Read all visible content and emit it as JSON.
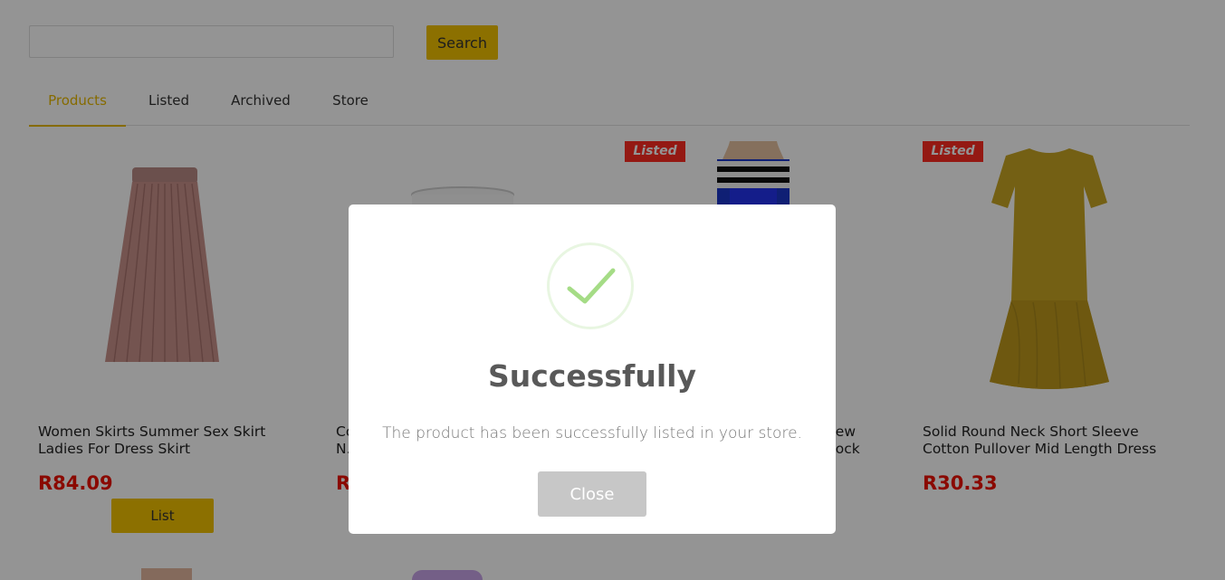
{
  "search": {
    "value": "",
    "placeholder": "",
    "button_label": "Search"
  },
  "tabs": [
    {
      "label": "Products",
      "active": true
    },
    {
      "label": "Listed",
      "active": false
    },
    {
      "label": "Archived",
      "active": false
    },
    {
      "label": "Store",
      "active": false
    }
  ],
  "products": [
    {
      "title": "Women Skirts Summer Sex Skirt Ladies For Dress Skirt",
      "price": "R84.09",
      "button_label": "List",
      "listed": false,
      "image": "pink-pleated-skirt",
      "color": "#c38e88"
    },
    {
      "title": "Co...",
      "title_line2": "N...",
      "price": "R...",
      "listed": false,
      "image": "glass-container",
      "color": "#e8e8e8"
    },
    {
      "title": "...ew",
      "title_line2": "...ock",
      "listed": true,
      "badge": "Listed",
      "image": "striped-dress",
      "color": "#1b36c9"
    },
    {
      "title": "Solid Round Neck Short Sleeve Cotton Pullover Mid Length Dress",
      "price": "R30.33",
      "listed": true,
      "badge": "Listed",
      "image": "yellow-dress",
      "color": "#c4a21f"
    }
  ],
  "modal": {
    "icon": "check-icon",
    "title": "Successfully",
    "message": "The product has been successfully listed in your store.",
    "close_label": "Close",
    "success_color": "#a5dc86"
  },
  "colors": {
    "accent": "#f2c200",
    "active_tab": "#e7b800",
    "price": "#ee1100",
    "badge": "#ff2b22"
  }
}
